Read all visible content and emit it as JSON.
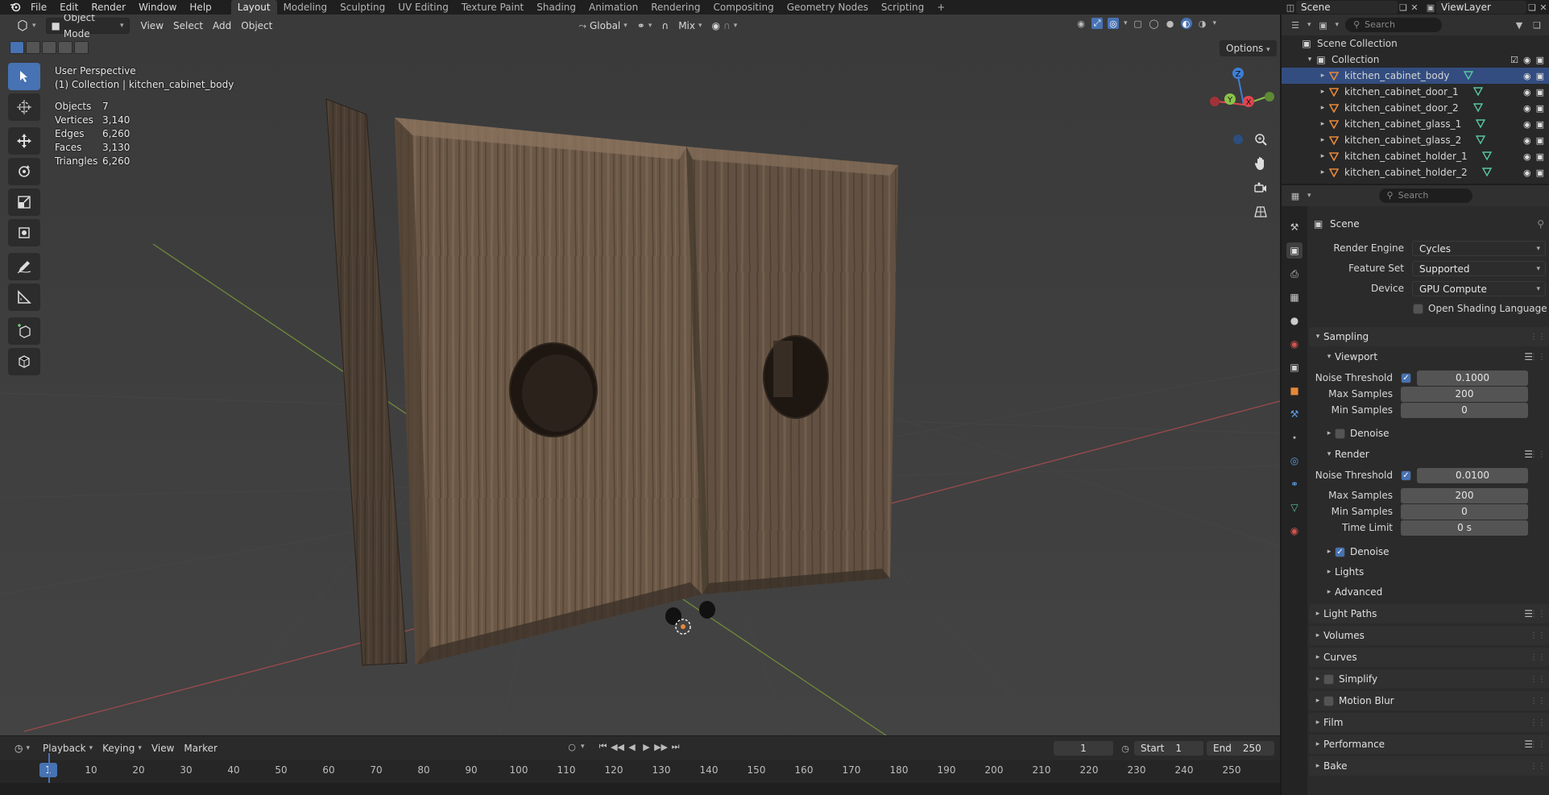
{
  "topbar": {
    "menus": [
      "File",
      "Edit",
      "Render",
      "Window",
      "Help"
    ],
    "workspaces": [
      "Layout",
      "Modeling",
      "Sculpting",
      "UV Editing",
      "Texture Paint",
      "Shading",
      "Animation",
      "Rendering",
      "Compositing",
      "Geometry Nodes",
      "Scripting"
    ],
    "active_workspace": "Layout",
    "add_tab": "+",
    "scene_name": "Scene",
    "view_layer": "ViewLayer"
  },
  "viewport": {
    "mode": "Object Mode",
    "menus": [
      "View",
      "Select",
      "Add",
      "Object"
    ],
    "transform_orientation": "Global",
    "snap_mode": "Mix",
    "options": "Options",
    "view_name": "User Perspective",
    "context": "(1) Collection | kitchen_cabinet_body",
    "stats": [
      {
        "label": "Objects",
        "value": "7"
      },
      {
        "label": "Vertices",
        "value": "3,140"
      },
      {
        "label": "Edges",
        "value": "6,260"
      },
      {
        "label": "Faces",
        "value": "3,130"
      },
      {
        "label": "Triangles",
        "value": "6,260"
      }
    ],
    "gizmo": {
      "z": "Z",
      "y": "Y",
      "x": "X"
    }
  },
  "timeline": {
    "menus": [
      "Playback",
      "Keying",
      "View",
      "Marker"
    ],
    "current_frame": "1",
    "start_label": "Start",
    "start": "1",
    "end_label": "End",
    "end": "250",
    "ticks": [
      "10",
      "20",
      "30",
      "40",
      "50",
      "60",
      "70",
      "80",
      "90",
      "100",
      "110",
      "120",
      "130",
      "140",
      "150",
      "160",
      "170",
      "180",
      "190",
      "200",
      "210",
      "220",
      "230",
      "240",
      "250"
    ],
    "marker": "1"
  },
  "outliner": {
    "search_placeholder": "Search",
    "scene_collection": "Scene Collection",
    "collection": "Collection",
    "objects": [
      "kitchen_cabinet_body",
      "kitchen_cabinet_door_1",
      "kitchen_cabinet_door_2",
      "kitchen_cabinet_glass_1",
      "kitchen_cabinet_glass_2",
      "kitchen_cabinet_holder_1",
      "kitchen_cabinet_holder_2"
    ],
    "selected": "kitchen_cabinet_body"
  },
  "properties": {
    "search_placeholder": "Search",
    "context": "Scene",
    "render_engine_label": "Render Engine",
    "render_engine": "Cycles",
    "feature_set_label": "Feature Set",
    "feature_set": "Supported",
    "device_label": "Device",
    "device": "GPU Compute",
    "osl_label": "Open Shading Language",
    "sampling": "Sampling",
    "viewport_panel": "Viewport",
    "noise_threshold_label": "Noise Threshold",
    "viewport_noise_threshold": "0.1000",
    "max_samples_label": "Max Samples",
    "viewport_max_samples": "200",
    "min_samples_label": "Min Samples",
    "viewport_min_samples": "0",
    "denoise_label": "Denoise",
    "render_panel": "Render",
    "render_noise_threshold": "0.0100",
    "render_max_samples": "200",
    "render_min_samples": "0",
    "time_limit_label": "Time Limit",
    "time_limit": "0 s",
    "lights": "Lights",
    "advanced": "Advanced",
    "panels": [
      "Light Paths",
      "Volumes",
      "Curves",
      "Simplify",
      "Motion Blur",
      "Film",
      "Performance",
      "Bake"
    ]
  },
  "colors": {
    "accent": "#4772b3",
    "selection": "#334d80",
    "axis_x": "#e2434f",
    "axis_y": "#8bc34a",
    "axis_z": "#3d7fd6"
  }
}
